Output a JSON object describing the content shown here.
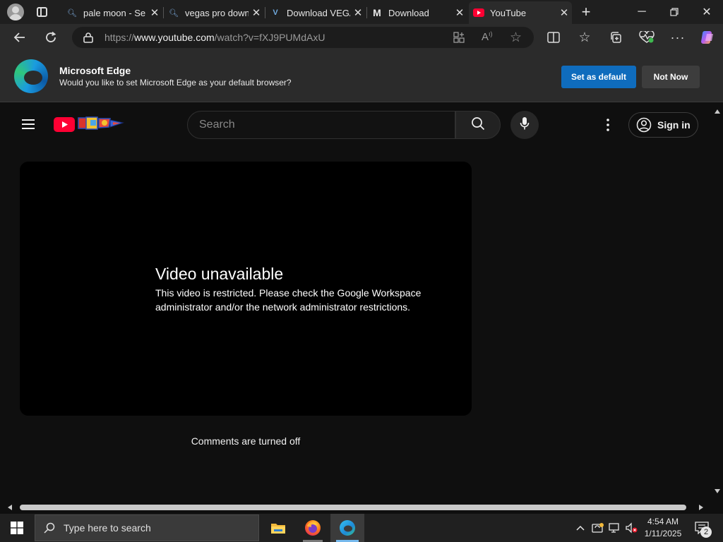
{
  "browser": {
    "tabs": [
      {
        "title": "pale moon - Se",
        "favicon": "search-favicon"
      },
      {
        "title": "vegas pro down",
        "favicon": "search-favicon"
      },
      {
        "title": "Download VEGA",
        "favicon": "V"
      },
      {
        "title": "Download",
        "favicon": "M"
      },
      {
        "title": "YouTube",
        "favicon": "youtube-favicon",
        "active": true
      }
    ],
    "url": {
      "prefix": "https://",
      "domain": "www.youtube.com",
      "path": "/watch?v=fXJ9PUMdAxU"
    }
  },
  "banner": {
    "title": "Microsoft Edge",
    "subtitle": "Would you like to set Microsoft Edge as your default browser?",
    "primary_label": "Set as default",
    "secondary_label": "Not Now",
    "primary_color": "#0f6cbd"
  },
  "youtube": {
    "search_placeholder": "Search",
    "sign_in_label": "Sign in",
    "error_title": "Video unavailable",
    "error_message": "This video is restricted. Please check the Google Workspace administrator and/or the network administrator restrictions.",
    "comments_status": "Comments are turned off",
    "brand_red": "#ff0033"
  },
  "taskbar": {
    "search_placeholder": "Type here to search",
    "time": "4:54 AM",
    "date": "1/11/2025",
    "notification_count": "2",
    "pinned": [
      "file-explorer-icon",
      "firefox-icon",
      "edge-icon"
    ]
  }
}
